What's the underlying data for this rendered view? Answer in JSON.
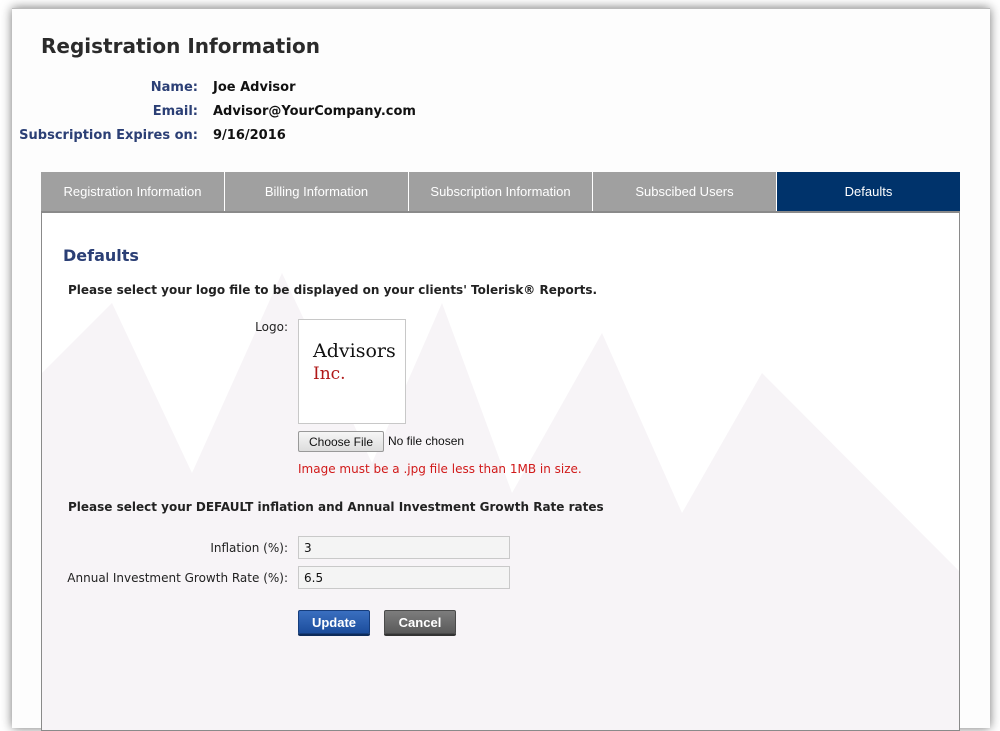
{
  "page": {
    "title": "Registration Information"
  },
  "registrant": {
    "name_label": "Name:",
    "name_value": "Joe Advisor",
    "email_label": "Email:",
    "email_value": "Advisor@YourCompany.com",
    "expires_label": "Subscription Expires on:",
    "expires_value": "9/16/2016"
  },
  "tabs": [
    {
      "label": "Registration Information",
      "active": false
    },
    {
      "label": "Billing Information",
      "active": false
    },
    {
      "label": "Subscription Information",
      "active": false
    },
    {
      "label": "Subscibed Users",
      "active": false
    },
    {
      "label": "Defaults",
      "active": true
    }
  ],
  "defaults": {
    "section_title": "Defaults",
    "logo_instruction": "Please select your logo file to be displayed on your clients' Tolerisk® Reports.",
    "logo_label": "Logo:",
    "logo_preview": {
      "line1": "Advisors",
      "line2": "Inc."
    },
    "file_button": "Choose File",
    "file_status": "No file chosen",
    "file_note": "Image must be a .jpg file less than 1MB in size.",
    "rates_instruction": "Please select your DEFAULT inflation and Annual Investment Growth Rate rates",
    "inflation_label": "Inflation (%):",
    "inflation_value": "3",
    "growth_label": "Annual Investment Growth Rate (%):",
    "growth_value": "6.5",
    "update_button": "Update",
    "cancel_button": "Cancel"
  },
  "colors": {
    "active_tab": "#00336b",
    "inactive_tab": "#a0a0a0",
    "label_blue": "#2b3f75",
    "error_red": "#d11a1a"
  }
}
